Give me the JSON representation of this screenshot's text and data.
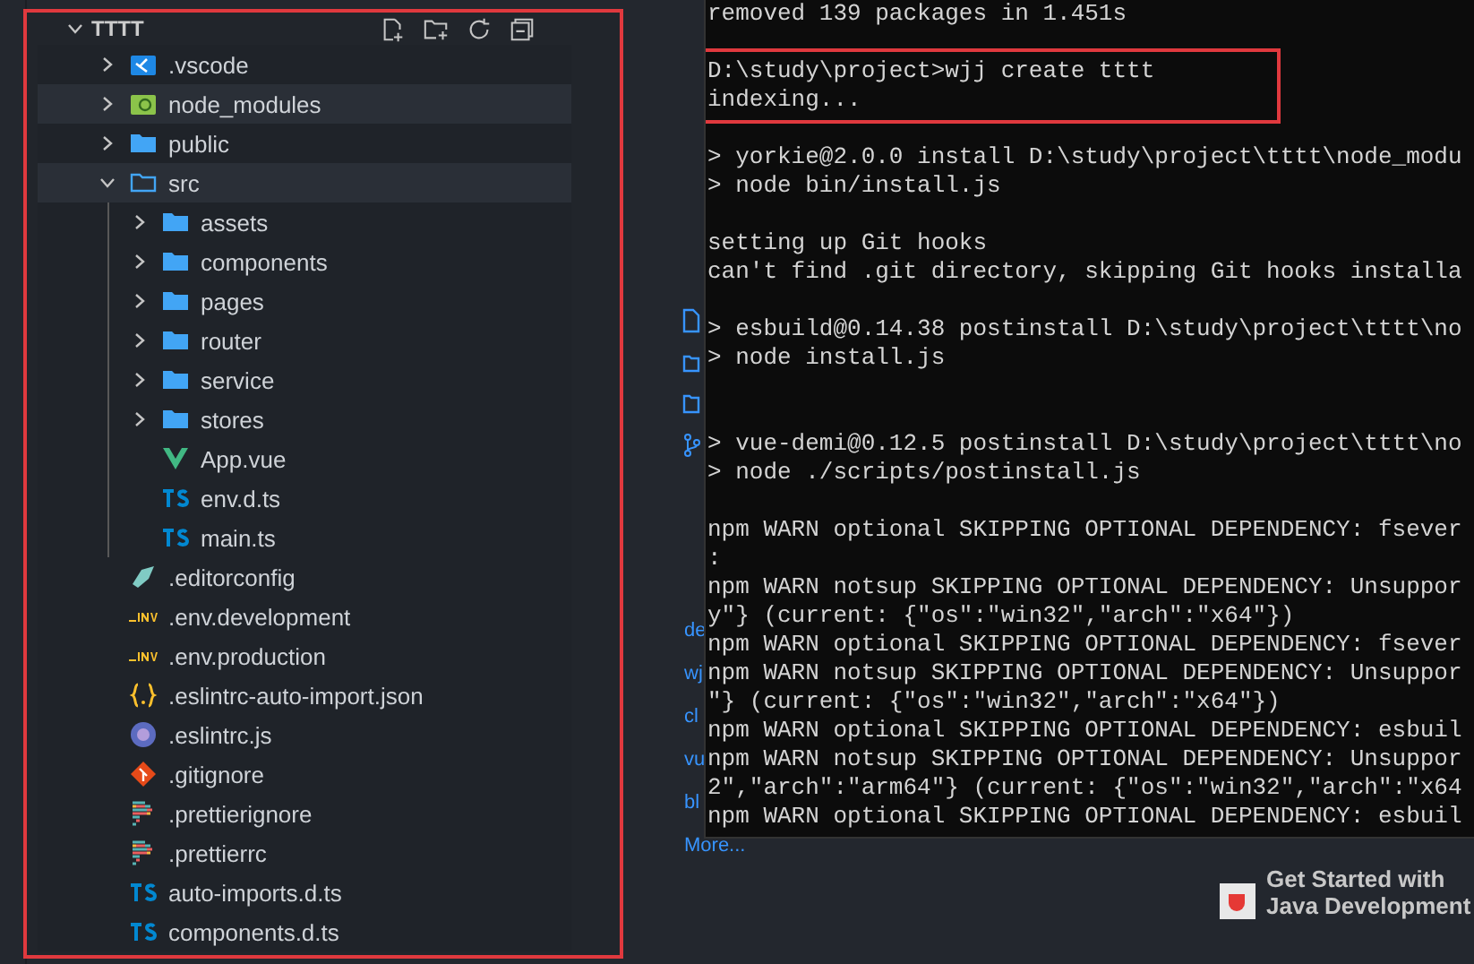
{
  "explorer": {
    "highlighted": true,
    "title": "TTTT",
    "tree": [
      {
        "label": ".vscode",
        "kind": "vscode",
        "expanded": false,
        "highlighted": false
      },
      {
        "label": "node_modules",
        "kind": "node",
        "expanded": false,
        "highlighted": true
      },
      {
        "label": "public",
        "kind": "folder",
        "expanded": false,
        "highlighted": false
      },
      {
        "label": "src",
        "kind": "folder",
        "expanded": true,
        "highlighted": true,
        "children": [
          {
            "label": "assets",
            "kind": "folder",
            "expanded": false,
            "highlighted": false
          },
          {
            "label": "components",
            "kind": "folder",
            "expanded": false,
            "highlighted": false
          },
          {
            "label": "pages",
            "kind": "folder",
            "expanded": false,
            "highlighted": false
          },
          {
            "label": "router",
            "kind": "folder",
            "expanded": false,
            "highlighted": false
          },
          {
            "label": "service",
            "kind": "folder",
            "expanded": false,
            "highlighted": false
          },
          {
            "label": "stores",
            "kind": "folder",
            "expanded": false,
            "highlighted": false
          },
          {
            "label": "App.vue",
            "kind": "vue",
            "highlighted": false
          },
          {
            "label": "env.d.ts",
            "kind": "ts",
            "highlighted": false
          },
          {
            "label": "main.ts",
            "kind": "ts",
            "highlighted": false
          }
        ]
      },
      {
        "label": ".editorconfig",
        "kind": "editorconfig",
        "highlighted": false
      },
      {
        "label": ".env.development",
        "kind": "env",
        "highlighted": false
      },
      {
        "label": ".env.production",
        "kind": "env",
        "highlighted": false
      },
      {
        "label": ".eslintrc-auto-import.json",
        "kind": "json",
        "highlighted": false
      },
      {
        "label": ".eslintrc.js",
        "kind": "eslint",
        "highlighted": false
      },
      {
        "label": ".gitignore",
        "kind": "git",
        "highlighted": false
      },
      {
        "label": ".prettierignore",
        "kind": "prettier",
        "highlighted": false
      },
      {
        "label": ".prettierrc",
        "kind": "prettier",
        "highlighted": false
      },
      {
        "label": "auto-imports.d.ts",
        "kind": "ts",
        "highlighted": false
      },
      {
        "label": "components.d.ts",
        "kind": "ts",
        "highlighted": false
      }
    ]
  },
  "welcome": {
    "links": [
      "de",
      "wj",
      "cl",
      "vu",
      "bl"
    ],
    "more": "More...",
    "card": {
      "title": "Get Started with",
      "subtitle": "Java Development"
    }
  },
  "terminal": {
    "blocks": [
      {
        "highlighted": false,
        "lines": [
          "removed 139 packages in 1.451s"
        ]
      },
      {
        "highlighted": true,
        "lines": [
          "D:\\study\\project>wjj create tttt",
          "indexing..."
        ]
      },
      {
        "highlighted": false,
        "lines": [
          "> yorkie@2.0.0 install D:\\study\\project\\tttt\\node_modu",
          "> node bin/install.js"
        ]
      },
      {
        "highlighted": false,
        "lines": [
          "setting up Git hooks",
          "can't find .git directory, skipping Git hooks installa"
        ]
      },
      {
        "highlighted": false,
        "lines": [
          "> esbuild@0.14.38 postinstall D:\\study\\project\\tttt\\no",
          "> node install.js"
        ]
      },
      {
        "highlighted": false,
        "lines": [
          "> vue-demi@0.12.5 postinstall D:\\study\\project\\tttt\\no",
          "> node ./scripts/postinstall.js"
        ]
      },
      {
        "highlighted": false,
        "lines": [
          "npm WARN optional SKIPPING OPTIONAL DEPENDENCY: fsever",
          ":",
          "npm WARN notsup SKIPPING OPTIONAL DEPENDENCY: Unsuppor",
          "y\"} (current: {\"os\":\"win32\",\"arch\":\"x64\"})",
          "npm WARN optional SKIPPING OPTIONAL DEPENDENCY: fsever",
          "npm WARN notsup SKIPPING OPTIONAL DEPENDENCY: Unsuppor",
          "\"} (current: {\"os\":\"win32\",\"arch\":\"x64\"})",
          "npm WARN optional SKIPPING OPTIONAL DEPENDENCY: esbuil",
          "npm WARN notsup SKIPPING OPTIONAL DEPENDENCY: Unsuppor",
          "2\",\"arch\":\"arm64\"} (current: {\"os\":\"win32\",\"arch\":\"x64",
          "npm WARN optional SKIPPING OPTIONAL DEPENDENCY: esbuil"
        ]
      }
    ]
  }
}
